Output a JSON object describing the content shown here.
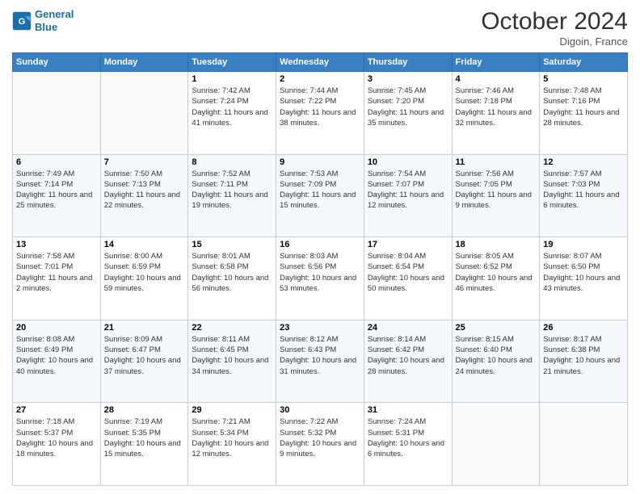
{
  "header": {
    "logo_line1": "General",
    "logo_line2": "Blue",
    "month": "October 2024",
    "location": "Digoin, France"
  },
  "days_of_week": [
    "Sunday",
    "Monday",
    "Tuesday",
    "Wednesday",
    "Thursday",
    "Friday",
    "Saturday"
  ],
  "weeks": [
    [
      {
        "day": "",
        "sunrise": "",
        "sunset": "",
        "daylight": ""
      },
      {
        "day": "",
        "sunrise": "",
        "sunset": "",
        "daylight": ""
      },
      {
        "day": "1",
        "sunrise": "Sunrise: 7:42 AM",
        "sunset": "Sunset: 7:24 PM",
        "daylight": "Daylight: 11 hours and 41 minutes."
      },
      {
        "day": "2",
        "sunrise": "Sunrise: 7:44 AM",
        "sunset": "Sunset: 7:22 PM",
        "daylight": "Daylight: 11 hours and 38 minutes."
      },
      {
        "day": "3",
        "sunrise": "Sunrise: 7:45 AM",
        "sunset": "Sunset: 7:20 PM",
        "daylight": "Daylight: 11 hours and 35 minutes."
      },
      {
        "day": "4",
        "sunrise": "Sunrise: 7:46 AM",
        "sunset": "Sunset: 7:18 PM",
        "daylight": "Daylight: 11 hours and 32 minutes."
      },
      {
        "day": "5",
        "sunrise": "Sunrise: 7:48 AM",
        "sunset": "Sunset: 7:16 PM",
        "daylight": "Daylight: 11 hours and 28 minutes."
      }
    ],
    [
      {
        "day": "6",
        "sunrise": "Sunrise: 7:49 AM",
        "sunset": "Sunset: 7:14 PM",
        "daylight": "Daylight: 11 hours and 25 minutes."
      },
      {
        "day": "7",
        "sunrise": "Sunrise: 7:50 AM",
        "sunset": "Sunset: 7:13 PM",
        "daylight": "Daylight: 11 hours and 22 minutes."
      },
      {
        "day": "8",
        "sunrise": "Sunrise: 7:52 AM",
        "sunset": "Sunset: 7:11 PM",
        "daylight": "Daylight: 11 hours and 19 minutes."
      },
      {
        "day": "9",
        "sunrise": "Sunrise: 7:53 AM",
        "sunset": "Sunset: 7:09 PM",
        "daylight": "Daylight: 11 hours and 15 minutes."
      },
      {
        "day": "10",
        "sunrise": "Sunrise: 7:54 AM",
        "sunset": "Sunset: 7:07 PM",
        "daylight": "Daylight: 11 hours and 12 minutes."
      },
      {
        "day": "11",
        "sunrise": "Sunrise: 7:56 AM",
        "sunset": "Sunset: 7:05 PM",
        "daylight": "Daylight: 11 hours and 9 minutes."
      },
      {
        "day": "12",
        "sunrise": "Sunrise: 7:57 AM",
        "sunset": "Sunset: 7:03 PM",
        "daylight": "Daylight: 11 hours and 6 minutes."
      }
    ],
    [
      {
        "day": "13",
        "sunrise": "Sunrise: 7:58 AM",
        "sunset": "Sunset: 7:01 PM",
        "daylight": "Daylight: 11 hours and 2 minutes."
      },
      {
        "day": "14",
        "sunrise": "Sunrise: 8:00 AM",
        "sunset": "Sunset: 6:59 PM",
        "daylight": "Daylight: 10 hours and 59 minutes."
      },
      {
        "day": "15",
        "sunrise": "Sunrise: 8:01 AM",
        "sunset": "Sunset: 6:58 PM",
        "daylight": "Daylight: 10 hours and 56 minutes."
      },
      {
        "day": "16",
        "sunrise": "Sunrise: 8:03 AM",
        "sunset": "Sunset: 6:56 PM",
        "daylight": "Daylight: 10 hours and 53 minutes."
      },
      {
        "day": "17",
        "sunrise": "Sunrise: 8:04 AM",
        "sunset": "Sunset: 6:54 PM",
        "daylight": "Daylight: 10 hours and 50 minutes."
      },
      {
        "day": "18",
        "sunrise": "Sunrise: 8:05 AM",
        "sunset": "Sunset: 6:52 PM",
        "daylight": "Daylight: 10 hours and 46 minutes."
      },
      {
        "day": "19",
        "sunrise": "Sunrise: 8:07 AM",
        "sunset": "Sunset: 6:50 PM",
        "daylight": "Daylight: 10 hours and 43 minutes."
      }
    ],
    [
      {
        "day": "20",
        "sunrise": "Sunrise: 8:08 AM",
        "sunset": "Sunset: 6:49 PM",
        "daylight": "Daylight: 10 hours and 40 minutes."
      },
      {
        "day": "21",
        "sunrise": "Sunrise: 8:09 AM",
        "sunset": "Sunset: 6:47 PM",
        "daylight": "Daylight: 10 hours and 37 minutes."
      },
      {
        "day": "22",
        "sunrise": "Sunrise: 8:11 AM",
        "sunset": "Sunset: 6:45 PM",
        "daylight": "Daylight: 10 hours and 34 minutes."
      },
      {
        "day": "23",
        "sunrise": "Sunrise: 8:12 AM",
        "sunset": "Sunset: 6:43 PM",
        "daylight": "Daylight: 10 hours and 31 minutes."
      },
      {
        "day": "24",
        "sunrise": "Sunrise: 8:14 AM",
        "sunset": "Sunset: 6:42 PM",
        "daylight": "Daylight: 10 hours and 28 minutes."
      },
      {
        "day": "25",
        "sunrise": "Sunrise: 8:15 AM",
        "sunset": "Sunset: 6:40 PM",
        "daylight": "Daylight: 10 hours and 24 minutes."
      },
      {
        "day": "26",
        "sunrise": "Sunrise: 8:17 AM",
        "sunset": "Sunset: 6:38 PM",
        "daylight": "Daylight: 10 hours and 21 minutes."
      }
    ],
    [
      {
        "day": "27",
        "sunrise": "Sunrise: 7:18 AM",
        "sunset": "Sunset: 5:37 PM",
        "daylight": "Daylight: 10 hours and 18 minutes."
      },
      {
        "day": "28",
        "sunrise": "Sunrise: 7:19 AM",
        "sunset": "Sunset: 5:35 PM",
        "daylight": "Daylight: 10 hours and 15 minutes."
      },
      {
        "day": "29",
        "sunrise": "Sunrise: 7:21 AM",
        "sunset": "Sunset: 5:34 PM",
        "daylight": "Daylight: 10 hours and 12 minutes."
      },
      {
        "day": "30",
        "sunrise": "Sunrise: 7:22 AM",
        "sunset": "Sunset: 5:32 PM",
        "daylight": "Daylight: 10 hours and 9 minutes."
      },
      {
        "day": "31",
        "sunrise": "Sunrise: 7:24 AM",
        "sunset": "Sunset: 5:31 PM",
        "daylight": "Daylight: 10 hours and 6 minutes."
      },
      {
        "day": "",
        "sunrise": "",
        "sunset": "",
        "daylight": ""
      },
      {
        "day": "",
        "sunrise": "",
        "sunset": "",
        "daylight": ""
      }
    ]
  ]
}
